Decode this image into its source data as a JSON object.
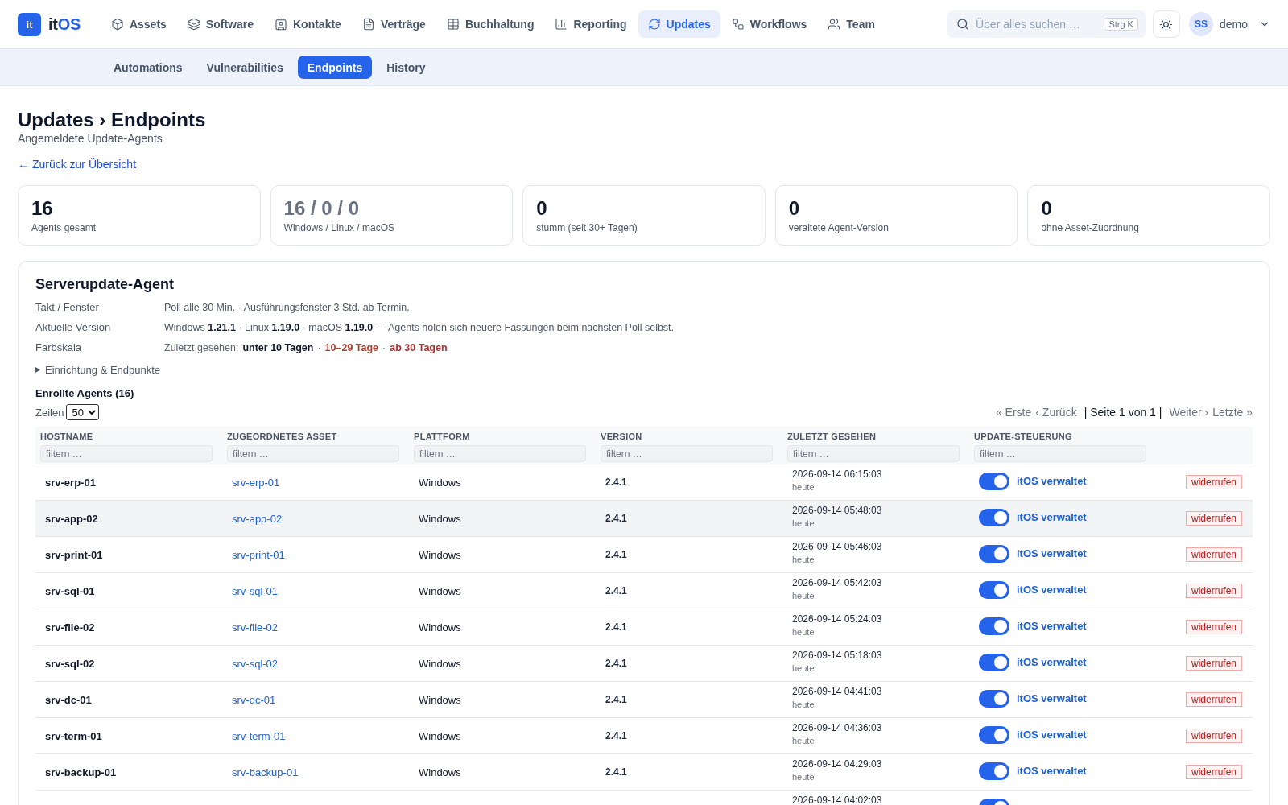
{
  "brand": {
    "tile": "it",
    "prefix": "it",
    "suffix": "OS"
  },
  "nav": {
    "items": [
      {
        "label": "Assets",
        "selected": false
      },
      {
        "label": "Software",
        "selected": false
      },
      {
        "label": "Kontakte",
        "selected": false
      },
      {
        "label": "Verträge",
        "selected": false
      },
      {
        "label": "Buchhaltung",
        "selected": false
      },
      {
        "label": "Reporting",
        "selected": false
      },
      {
        "label": "Updates",
        "selected": true
      },
      {
        "label": "Workflows",
        "selected": false
      },
      {
        "label": "Team",
        "selected": false
      }
    ]
  },
  "search": {
    "placeholder": "Über alles suchen …",
    "shortcut": "Strg K"
  },
  "user": {
    "initials": "SS",
    "name": "demo"
  },
  "subnav": [
    {
      "label": "Automations",
      "selected": false
    },
    {
      "label": "Vulnerabilities",
      "selected": false
    },
    {
      "label": "Endpoints",
      "selected": true
    },
    {
      "label": "History",
      "selected": false
    }
  ],
  "page": {
    "title": "Updates › Endpoints",
    "subtitle": "Angemeldete Update-Agents",
    "back_link": "← Zurück zur Übersicht"
  },
  "stats": [
    {
      "value": "16",
      "label": "Agents gesamt",
      "kind": "count"
    },
    {
      "value": "16 / 0 / 0",
      "label": "Windows / Linux / macOS",
      "kind": "split"
    },
    {
      "value": "0",
      "label": "stumm (seit 30+ Tagen)",
      "kind": "count"
    },
    {
      "value": "0",
      "label": "veraltete Agent-Version",
      "kind": "count"
    },
    {
      "value": "0",
      "label": "ohne Asset-Zuordnung",
      "kind": "count"
    }
  ],
  "agent_panel": {
    "title": "Serverupdate-Agent",
    "fields": [
      {
        "label": "Takt / Fenster",
        "kind": "text",
        "value": "Poll alle 30 Min. · Ausführungsfenster 3 Std. ab Termin."
      },
      {
        "label": "Aktuelle Version",
        "kind": "text",
        "value": "Windows **1.21.1** · Linux **1.19.0** · macOS **1.19.0** — Agents holen sich neuere Fassungen beim nächsten Poll selbst."
      },
      {
        "label": "Farbskala",
        "kind": "legend",
        "prefix": "Zuletzt gesehen:",
        "separator": "·",
        "items": [
          {
            "label": "unter 10 Tagen",
            "color": "#0f172a"
          },
          {
            "label": "10–29 Tage",
            "color": "#a8402f"
          },
          {
            "label": "ab 30 Tagen",
            "color": "#a83232"
          }
        ]
      }
    ],
    "details": {
      "label": "Einrichtung & Endpunkte",
      "expanded": false
    }
  },
  "agents": {
    "title": "Enrollte Agents (16)",
    "page_size_label": "Zeilen",
    "page_size": "50",
    "pagination": [
      {
        "kind": "link",
        "label": "« Erste",
        "disabled": true
      },
      {
        "kind": "link",
        "label": "‹ Zurück",
        "disabled": true
      },
      {
        "kind": "info",
        "label": "| Seite 1 von 1 |"
      },
      {
        "kind": "link",
        "label": "Weiter ›",
        "disabled": true
      },
      {
        "kind": "link",
        "label": "Letzte »",
        "disabled": true
      }
    ],
    "columns": [
      {
        "label": "HOSTNAME",
        "filter_placeholder": "filtern …"
      },
      {
        "label": "ZUGEORDNETES ASSET",
        "filter_placeholder": "filtern …"
      },
      {
        "label": "PLATTFORM",
        "filter_placeholder": "filtern …"
      },
      {
        "label": "VERSION",
        "filter_placeholder": "filtern …"
      },
      {
        "label": "ZULETZT GESEHEN",
        "filter_placeholder": "filtern …"
      },
      {
        "label": "UPDATE-STEUERUNG",
        "filter_placeholder": "filtern …"
      }
    ],
    "rows": [
      {
        "hostname": "srv-erp-01",
        "asset": "srv-erp-01",
        "platform": "Windows",
        "version": "2.4.1",
        "last_seen": "2026-09-14 06:15:03",
        "last_seen_relative": "heute",
        "managed": true,
        "control_label": "itOS verwaltet",
        "action": "widerrufen",
        "highlighted": false
      },
      {
        "hostname": "srv-app-02",
        "asset": "srv-app-02",
        "platform": "Windows",
        "version": "2.4.1",
        "last_seen": "2026-09-14 05:48:03",
        "last_seen_relative": "heute",
        "managed": true,
        "control_label": "itOS verwaltet",
        "action": "widerrufen",
        "highlighted": true
      },
      {
        "hostname": "srv-print-01",
        "asset": "srv-print-01",
        "platform": "Windows",
        "version": "2.4.1",
        "last_seen": "2026-09-14 05:46:03",
        "last_seen_relative": "heute",
        "managed": true,
        "control_label": "itOS verwaltet",
        "action": "widerrufen",
        "highlighted": false
      },
      {
        "hostname": "srv-sql-01",
        "asset": "srv-sql-01",
        "platform": "Windows",
        "version": "2.4.1",
        "last_seen": "2026-09-14 05:42:03",
        "last_seen_relative": "heute",
        "managed": true,
        "control_label": "itOS verwaltet",
        "action": "widerrufen",
        "highlighted": false
      },
      {
        "hostname": "srv-file-02",
        "asset": "srv-file-02",
        "platform": "Windows",
        "version": "2.4.1",
        "last_seen": "2026-09-14 05:24:03",
        "last_seen_relative": "heute",
        "managed": true,
        "control_label": "itOS verwaltet",
        "action": "widerrufen",
        "highlighted": false
      },
      {
        "hostname": "srv-sql-02",
        "asset": "srv-sql-02",
        "platform": "Windows",
        "version": "2.4.1",
        "last_seen": "2026-09-14 05:18:03",
        "last_seen_relative": "heute",
        "managed": true,
        "control_label": "itOS verwaltet",
        "action": "widerrufen",
        "highlighted": false
      },
      {
        "hostname": "srv-dc-01",
        "asset": "srv-dc-01",
        "platform": "Windows",
        "version": "2.4.1",
        "last_seen": "2026-09-14 04:41:03",
        "last_seen_relative": "heute",
        "managed": true,
        "control_label": "itOS verwaltet",
        "action": "widerrufen",
        "highlighted": false
      },
      {
        "hostname": "srv-term-01",
        "asset": "srv-term-01",
        "platform": "Windows",
        "version": "2.4.1",
        "last_seen": "2026-09-14 04:36:03",
        "last_seen_relative": "heute",
        "managed": true,
        "control_label": "itOS verwaltet",
        "action": "widerrufen",
        "highlighted": false
      },
      {
        "hostname": "srv-backup-01",
        "asset": "srv-backup-01",
        "platform": "Windows",
        "version": "2.4.1",
        "last_seen": "2026-09-14 04:29:03",
        "last_seen_relative": "heute",
        "managed": true,
        "control_label": "itOS verwaltet",
        "action": "widerrufen",
        "highlighted": false
      },
      {
        "last_seen": "2026-09-14 04:02:03",
        "managed": true,
        "highlighted": false
      }
    ]
  }
}
